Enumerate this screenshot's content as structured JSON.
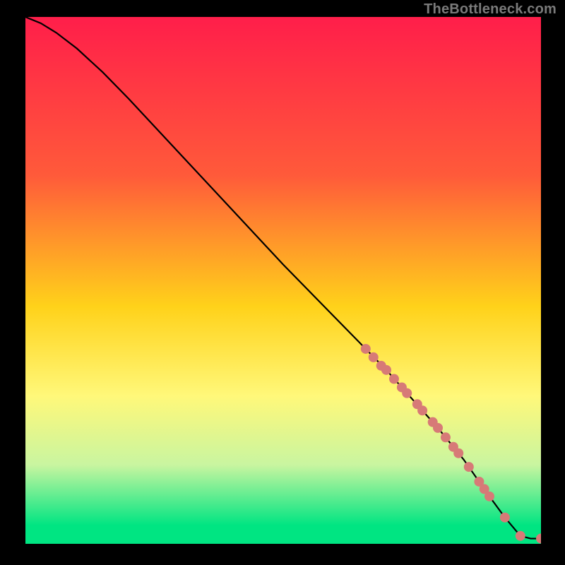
{
  "watermark": "TheBottleneck.com",
  "chart_data": {
    "type": "line",
    "title": "",
    "xlabel": "",
    "ylabel": "",
    "xlim": [
      0,
      100
    ],
    "ylim": [
      0,
      100
    ],
    "grid": false,
    "background_gradient_stops": [
      {
        "offset": 0.0,
        "color": "#ff1e4a"
      },
      {
        "offset": 0.3,
        "color": "#ff5a3a"
      },
      {
        "offset": 0.55,
        "color": "#ffd21a"
      },
      {
        "offset": 0.72,
        "color": "#fff87a"
      },
      {
        "offset": 0.85,
        "color": "#c9f5a0"
      },
      {
        "offset": 0.965,
        "color": "#00e582"
      },
      {
        "offset": 1.0,
        "color": "#00e582"
      }
    ],
    "series": [
      {
        "name": "bottleneck-curve",
        "color": "#000000",
        "x": [
          0,
          3,
          6,
          10,
          15,
          20,
          30,
          40,
          50,
          60,
          66,
          70,
          75,
          80,
          85,
          90,
          93,
          96,
          98,
          100
        ],
        "y": [
          100,
          98.8,
          97.0,
          94.0,
          89.5,
          84.5,
          74.0,
          63.5,
          53.0,
          43.0,
          37.0,
          33.0,
          27.5,
          22.0,
          16.0,
          9.0,
          5.0,
          1.5,
          1.0,
          1.0
        ]
      }
    ],
    "markers": {
      "name": "highlight-points",
      "color": "#d77a77",
      "radius_px": 7,
      "points": [
        {
          "x": 66,
          "y": 37
        },
        {
          "x": 67.5,
          "y": 35.4
        },
        {
          "x": 69,
          "y": 33.8
        },
        {
          "x": 70,
          "y": 33.0
        },
        {
          "x": 71.5,
          "y": 31.3
        },
        {
          "x": 73,
          "y": 29.7
        },
        {
          "x": 74,
          "y": 28.6
        },
        {
          "x": 76,
          "y": 26.5
        },
        {
          "x": 77,
          "y": 25.3
        },
        {
          "x": 79,
          "y": 23.1
        },
        {
          "x": 80,
          "y": 22.0
        },
        {
          "x": 81.5,
          "y": 20.2
        },
        {
          "x": 83,
          "y": 18.4
        },
        {
          "x": 84,
          "y": 17.2
        },
        {
          "x": 86,
          "y": 14.6
        },
        {
          "x": 88,
          "y": 11.8
        },
        {
          "x": 89,
          "y": 10.4
        },
        {
          "x": 90,
          "y": 9.0
        },
        {
          "x": 93,
          "y": 5.0
        },
        {
          "x": 96,
          "y": 1.5
        },
        {
          "x": 100,
          "y": 1.0
        }
      ]
    }
  }
}
